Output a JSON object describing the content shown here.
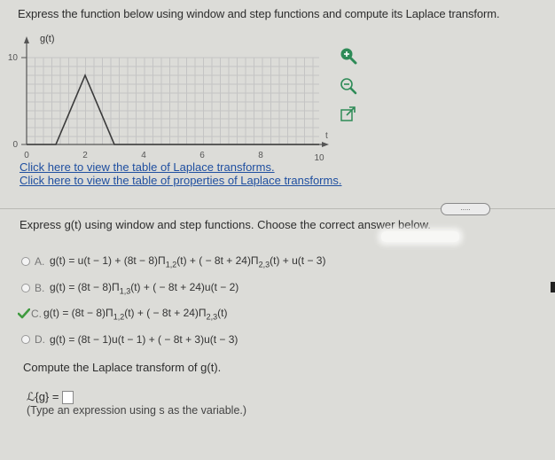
{
  "question": "Express the function below using window and step functions and compute its Laplace transform.",
  "graph": {
    "ylabel": "g(t)",
    "y_ticks": [
      "10",
      "0"
    ],
    "x_ticks": [
      "0",
      "2",
      "4",
      "6",
      "8",
      "10"
    ],
    "x_label": "t"
  },
  "links": [
    "Click here to view the table of Laplace transforms.",
    "Click here to view the table of properties of Laplace transforms."
  ],
  "more_button": ".....",
  "prompt": "Express g(t) using window and step functions. Choose the correct answer below.",
  "options": [
    {
      "letter": "A.",
      "prefix": "g(t) = u(t − 1) + (8t − 8)Π",
      "sub1": "1,2",
      "mid": "(t) + ( − 8t + 24)Π",
      "sub2": "2,3",
      "suffix": "(t) + u(t − 3)"
    },
    {
      "letter": "B.",
      "prefix": "g(t) = (8t − 8)Π",
      "sub1": "1,3",
      "mid": "(t) + ( − 8t + 24)u(t − 2)",
      "sub2": "",
      "suffix": ""
    },
    {
      "letter": "C.",
      "prefix": "g(t) = (8t − 8)Π",
      "sub1": "1,2",
      "mid": "(t) + ( − 8t + 24)Π",
      "sub2": "2,3",
      "suffix": "(t)"
    },
    {
      "letter": "D.",
      "prefix": "g(t) = (8t − 1)u(t − 1) + ( − 8t + 3)u(t − 3)",
      "sub1": "",
      "mid": "",
      "sub2": "",
      "suffix": ""
    }
  ],
  "selected_option": "C.",
  "compute_label": "Compute the Laplace transform of g(t).",
  "answer_label": "ℒ{g} =",
  "hint": "(Type an expression using s as the variable.)",
  "colors": {
    "link": "#1f4fa0",
    "check": "#3f9a3f",
    "zoom": "#2e8b57"
  }
}
